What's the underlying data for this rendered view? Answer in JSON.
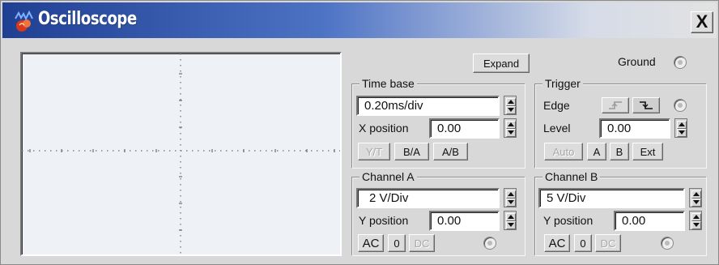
{
  "window": {
    "title": "Oscilloscope",
    "close_label": "X"
  },
  "display": {
    "expand_label": "Expand",
    "ground_label": "Ground"
  },
  "timebase": {
    "title": "Time base",
    "value": "0.20ms/div",
    "xpos_label": "X position",
    "xpos_value": "0.00",
    "modes": [
      "Y/T",
      "B/A",
      "A/B"
    ]
  },
  "trigger": {
    "title": "Trigger",
    "edge_label": "Edge",
    "level_label": "Level",
    "level_value": "0.00",
    "modes": [
      "Auto",
      "A",
      "B",
      "Ext"
    ]
  },
  "channel_a": {
    "title": "Channel A",
    "value": "2 V/Div",
    "ypos_label": "Y position",
    "ypos_value": "0.00",
    "couplings": [
      "AC",
      "0",
      "DC"
    ]
  },
  "channel_b": {
    "title": "Channel B",
    "value": "5 V/Div",
    "ypos_label": "Y position",
    "ypos_value": "0.00",
    "couplings": [
      "AC",
      "0",
      "DC"
    ]
  },
  "icons": [
    "oscilloscope-app-icon",
    "close-icon",
    "rising-edge-icon",
    "falling-edge-icon",
    "spinner-up-icon",
    "spinner-down-icon"
  ],
  "colors": {
    "title_start": "#1f3f93",
    "title_end": "#e2e2e2",
    "panel_bg": "#d8d8d8",
    "screen_bg": "#eef2f7"
  }
}
